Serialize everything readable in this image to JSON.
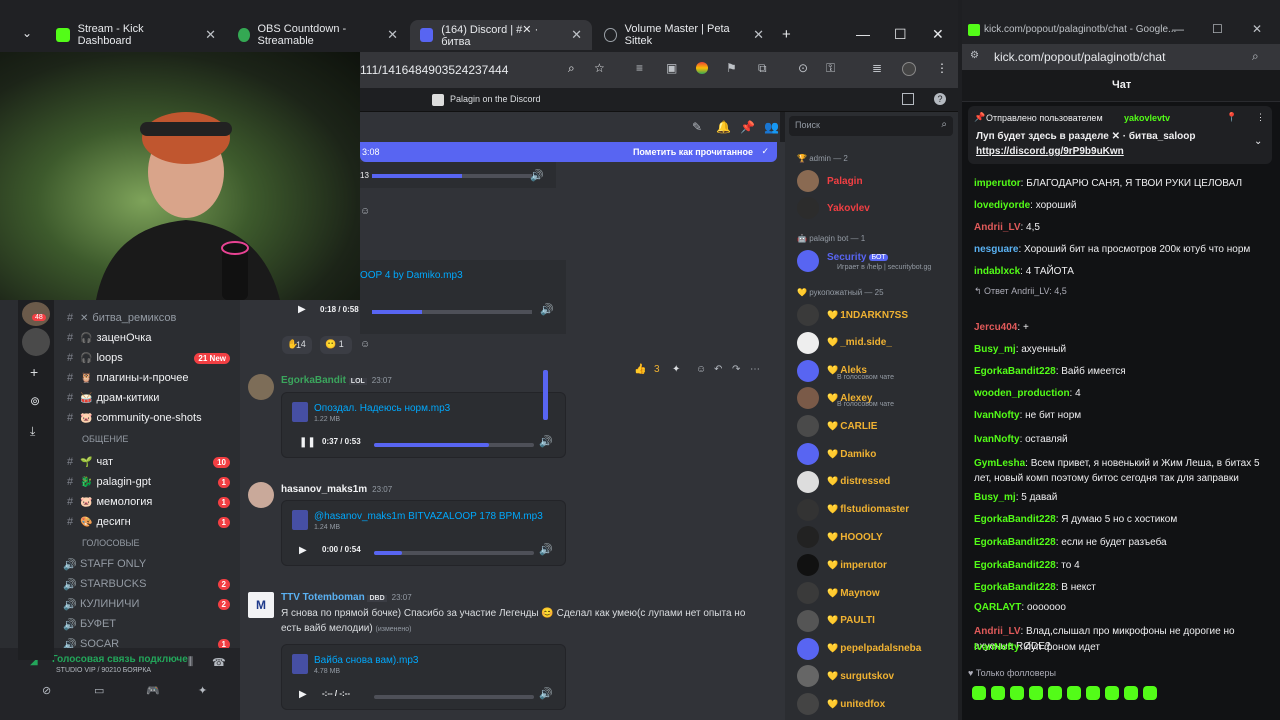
{
  "browser": {
    "tabs": [
      {
        "label": "Stream - Kick Dashboard",
        "color": "#53fc18"
      },
      {
        "label": "OBS Countdown - Streamable",
        "color": "#34a853"
      },
      {
        "label": "(164) Discord | #✕ · битва",
        "color": "#5865f2"
      },
      {
        "label": "Volume Master | Peta Sittek",
        "color": "#9aa0a6"
      }
    ],
    "url": "111/1416484903524237444"
  },
  "discord": {
    "server_banner": "Palagin on the Discord",
    "search_placeholder": "Поиск",
    "new_bar_time": "3:08",
    "mark_read": "Пометить как прочитанное",
    "channels": [
      {
        "name": "битва_ремиксов",
        "emoji": "✕",
        "badge": ""
      },
      {
        "name": "заценОчка",
        "emoji": "🎧",
        "badge": ""
      },
      {
        "name": "loops",
        "emoji": "🎧",
        "badge": "21 New"
      },
      {
        "name": "плагины-и-прочее",
        "emoji": "🦉",
        "badge": ""
      },
      {
        "name": "драм-китики",
        "emoji": "🥁",
        "badge": ""
      },
      {
        "name": "community-one-shots",
        "emoji": "🐷",
        "badge": ""
      }
    ],
    "cat_social": "ОБЩЕНИЕ",
    "social_channels": [
      {
        "name": "чат",
        "emoji": "🌱",
        "badge": "10"
      },
      {
        "name": "palagin-gpt",
        "emoji": "🐉",
        "badge": "1"
      },
      {
        "name": "мемология",
        "emoji": "🐷",
        "badge": "1"
      },
      {
        "name": "десигн",
        "emoji": "🎨",
        "badge": "1"
      }
    ],
    "cat_voice": "ГОЛОСОВЫЕ",
    "voice_channels": [
      {
        "name": "STAFF ONLY",
        "badge": ""
      },
      {
        "name": "STARBUCKS",
        "badge": "2"
      },
      {
        "name": "КУЛИНИЧИ",
        "badge": "2"
      },
      {
        "name": "БУФЕТ",
        "badge": ""
      },
      {
        "name": "SOCAR",
        "badge": "1"
      }
    ],
    "voice_status": "Голосовая связь подключе",
    "voice_sub": "STUDIO VIP / 90210 БОЯРКА",
    "messages": {
      "top_time": "13",
      "damiko_file": "OOP 4 by Damiko.mp3",
      "damiko_time": "0:18 / 0:58",
      "reactions": [
        "4",
        "1",
        "1"
      ],
      "egorka_name": "EgorkaBandit",
      "egorka_tag": "LOL",
      "egorka_ts": "23:07",
      "egorka_file": "Опоздал. Надеюсь норм.mp3",
      "egorka_size": "1.22 MB",
      "egorka_time": "0:37 / 0:53",
      "hasanov_name": "hasanov_maks1m",
      "hasanov_ts": "23:07",
      "hasanov_file": "@hasanov_maks1m BITVAZALOOP 178 BPM.mp3",
      "hasanov_size": "1.24 MB",
      "hasanov_time": "0:00 / 0:54",
      "ttv_name": "TTV Totemboman",
      "ttv_tag": "DBD",
      "ttv_ts": "23:07",
      "ttv_text1": "Я снова по прямой бочке) Спасибо за участие Легенды",
      "ttv_text1b": "Сделал как умею(с лупами нет опыта но",
      "ttv_text2": "есть вайб мелодии)",
      "ttv_edited": "(изменено)",
      "ttv_file": "Вайба снова вам).mp3",
      "ttv_size": "4.78 MB",
      "ttv_time": "-:-- / -:--"
    },
    "members": {
      "admin_hdr": "admin — 2",
      "admins": [
        "Palagin",
        "Yakovlev"
      ],
      "bot_hdr": "Palagin bot — 1",
      "bot_name": "Security",
      "bot_tag": "БОТ",
      "bot_sub": "Играет в /help | securitybot.gg",
      "hand_hdr": "рукопожатный — 25",
      "list": [
        {
          "name": "1NDARKN7SS",
          "sub": ""
        },
        {
          "name": "_mid.side_",
          "sub": ""
        },
        {
          "name": "Aleks",
          "sub": "В голосовом чате"
        },
        {
          "name": "Alexey",
          "sub": "В голосовом чате"
        },
        {
          "name": "CARLIE",
          "sub": ""
        },
        {
          "name": "Damiko",
          "sub": ""
        },
        {
          "name": "distressed",
          "sub": ""
        },
        {
          "name": "flstudiomaster",
          "sub": ""
        },
        {
          "name": "HOOOLY",
          "sub": ""
        },
        {
          "name": "imperutor",
          "sub": ""
        },
        {
          "name": "Maynow",
          "sub": ""
        },
        {
          "name": "PAULTI",
          "sub": ""
        },
        {
          "name": "pepelpadalsneba",
          "sub": ""
        },
        {
          "name": "surgutskov",
          "sub": ""
        },
        {
          "name": "unitedfox",
          "sub": ""
        }
      ]
    }
  },
  "kick": {
    "titlebar": "kick.com/popout/palaginotb/chat - Google...",
    "url": "kick.com/popout/palaginotb/chat",
    "header": "Чат",
    "pinned_by": "Отправлено пользователем",
    "pinned_user": "yakovlevtv",
    "pinned_text": "Луп будет здесь в разделе ✕ · битва_saloop",
    "pinned_link": "https://discord.gg/9rP9b9uKwn",
    "followers_only": "Только фолловеры",
    "messages": [
      {
        "user": "imperutor",
        "color": "#53fc18",
        "text": "БЛАГОДАРЮ САНЯ, Я ТВОИ РУКИ ЦЕЛОВАЛ"
      },
      {
        "user": "lovediyorde",
        "color": "#53fc18",
        "text": "хороший"
      },
      {
        "user": "Andrii_LV",
        "color": "#e05a5a",
        "text": "4,5"
      },
      {
        "user": "nesguare",
        "color": "#5ab1f2",
        "text": "Хороший бит на просмотров 200к ютуб что норм"
      },
      {
        "user": "indablxck",
        "color": "#53fc18",
        "text": "4 ТАЙОТА"
      },
      {
        "user": "Jercu404",
        "color": "#e05a5a",
        "text": "+"
      },
      {
        "user": "Busy_mj",
        "color": "#53fc18",
        "text": "ахуенный"
      },
      {
        "user": "EgorkaBandit228",
        "color": "#53fc18",
        "text": "Вайб имеется"
      },
      {
        "user": "wooden_production",
        "color": "#53fc18",
        "text": "4"
      },
      {
        "user": "IvanNofty",
        "color": "#53fc18",
        "text": "не бит норм"
      },
      {
        "user": "IvanNofty",
        "color": "#53fc18",
        "text": "оставляй"
      },
      {
        "user": "GymLesha",
        "color": "#53fc18",
        "text": "Всем привет, я новенький и Жим Леша, в битах 5 лет, новый комп поэтому битос сегодня так для заправки"
      },
      {
        "user": "Busy_mj",
        "color": "#53fc18",
        "text": "5 давай"
      },
      {
        "user": "EgorkaBandit228",
        "color": "#53fc18",
        "text": "Я думаю 5 но с хостиком"
      },
      {
        "user": "EgorkaBandit228",
        "color": "#53fc18",
        "text": "если не будет разъеба"
      },
      {
        "user": "EgorkaBandit228",
        "color": "#53fc18",
        "text": "то 4"
      },
      {
        "user": "EgorkaBandit228",
        "color": "#53fc18",
        "text": "В некст"
      },
      {
        "user": "QARLAYT",
        "color": "#53fc18",
        "text": "ооооооо"
      },
      {
        "user": "Andrii_LV",
        "color": "#e05a5a",
        "text": "Влад,слышал про микрофоны не дорогие но ахуеные RØDE?"
      },
      {
        "user": "IvanNofty",
        "color": "#53fc18",
        "text": "луп фоном идет"
      }
    ],
    "reply_label": "Ответ Andrii_LV: 4,5"
  }
}
